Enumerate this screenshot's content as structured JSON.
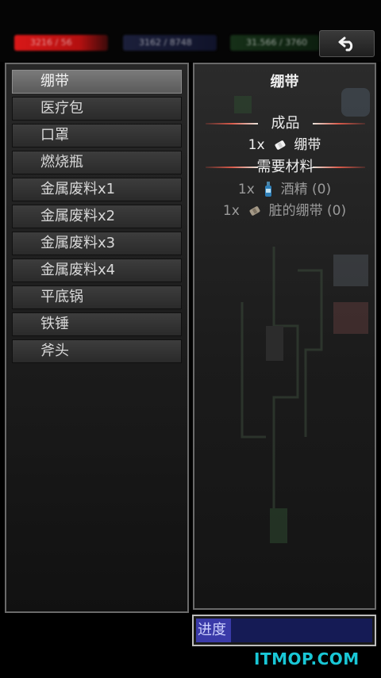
{
  "top_bar": {
    "stats": [
      {
        "id": "hp",
        "text": "3216 / 56"
      },
      {
        "id": "food",
        "text": "3162 / 8748"
      },
      {
        "id": "water",
        "text": "31.566 / 3760"
      }
    ],
    "back_icon": "undo-arrow-icon"
  },
  "recipe_list": {
    "items": [
      "绷带",
      "医疗包",
      "口罩",
      "燃烧瓶",
      "金属废料x1",
      "金属废料x2",
      "金属废料x3",
      "金属废料x4",
      "平底锅",
      "铁锤",
      "斧头"
    ],
    "selected_index": 0
  },
  "detail": {
    "title": "绷带",
    "product_header": "成品",
    "product": {
      "qty": "1x",
      "icon": "bandage-icon",
      "name": "绷带"
    },
    "materials_header": "需要材料",
    "materials": [
      {
        "qty": "1x",
        "icon": "alcohol-bottle-icon",
        "name": "酒精 (0)"
      },
      {
        "qty": "1x",
        "icon": "dirty-bandage-icon",
        "name": "脏的绷带 (0)"
      }
    ]
  },
  "progress": {
    "label": "进度",
    "value": 0.2
  },
  "watermark": "ITMOP.COM",
  "colors": {
    "accent_red": "#d85a4a",
    "progress_blue": "#151b55",
    "watermark": "#19c7d6"
  }
}
